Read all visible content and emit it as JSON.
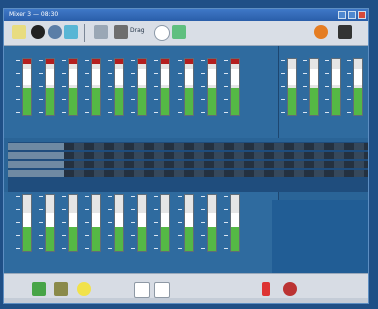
{
  "window": {
    "title": "Mixer 3 — 08:30"
  },
  "toolbar": {
    "buttons": [
      {
        "name": "pointer-icon",
        "color": "#e8dc80"
      },
      {
        "name": "drop-icon",
        "color": "#222"
      },
      {
        "name": "clock-icon",
        "color": "#5b7ea7"
      },
      {
        "name": "grid-icon",
        "color": "#58b6d5"
      },
      {
        "name": "divider-icon",
        "color": "#7b8797"
      },
      {
        "name": "panel-icon",
        "color": "#9aa7b5"
      },
      {
        "name": "pen-icon",
        "color": "#6e6e6e"
      },
      {
        "name": "drag-label",
        "label": "Drag"
      },
      {
        "name": "circle-icon",
        "color": "#ffffff"
      },
      {
        "name": "leaf-icon",
        "color": "#5fbf7f"
      },
      {
        "name": "warning-icon",
        "color": "#e57d22"
      },
      {
        "name": "person-icon",
        "color": "#333"
      }
    ]
  },
  "sections": {
    "top_faders": [
      {
        "name": "fader-1",
        "red": true
      },
      {
        "name": "fader-2",
        "red": true
      },
      {
        "name": "fader-3",
        "red": true
      },
      {
        "name": "fader-4",
        "red": true
      },
      {
        "name": "fader-5",
        "red": true
      },
      {
        "name": "fader-6",
        "red": true
      },
      {
        "name": "fader-7",
        "red": true
      },
      {
        "name": "fader-8",
        "red": true
      },
      {
        "name": "fader-9",
        "red": true
      },
      {
        "name": "fader-10",
        "red": true
      },
      {
        "name": "fader-11",
        "red": false
      },
      {
        "name": "fader-12",
        "red": false
      },
      {
        "name": "fader-13",
        "red": false
      },
      {
        "name": "fader-14",
        "red": false
      }
    ],
    "middle_rows": [
      {
        "name": "row-1"
      },
      {
        "name": "row-2"
      },
      {
        "name": "row-3"
      },
      {
        "name": "row-4"
      }
    ],
    "bottom_faders": [
      {
        "name": "fader-b1"
      },
      {
        "name": "fader-b2"
      },
      {
        "name": "fader-b3"
      },
      {
        "name": "fader-b4"
      },
      {
        "name": "fader-b5"
      },
      {
        "name": "fader-b6"
      },
      {
        "name": "fader-b7"
      },
      {
        "name": "fader-b8"
      },
      {
        "name": "fader-b9"
      },
      {
        "name": "fader-b10"
      }
    ]
  },
  "bottom_toolbar": {
    "buttons": [
      {
        "name": "camera-icon",
        "color": "#47a447"
      },
      {
        "name": "tape-icon",
        "color": "#8a8a4a"
      },
      {
        "name": "smile-icon",
        "color": "#f1e24a"
      },
      {
        "name": "cursor-a-icon",
        "color": "#ffffff"
      },
      {
        "name": "cursor-b-icon",
        "color": "#ffffff"
      },
      {
        "name": "traffic-icon",
        "color": "#d33"
      },
      {
        "name": "settings-icon",
        "color": "#b33"
      }
    ]
  }
}
